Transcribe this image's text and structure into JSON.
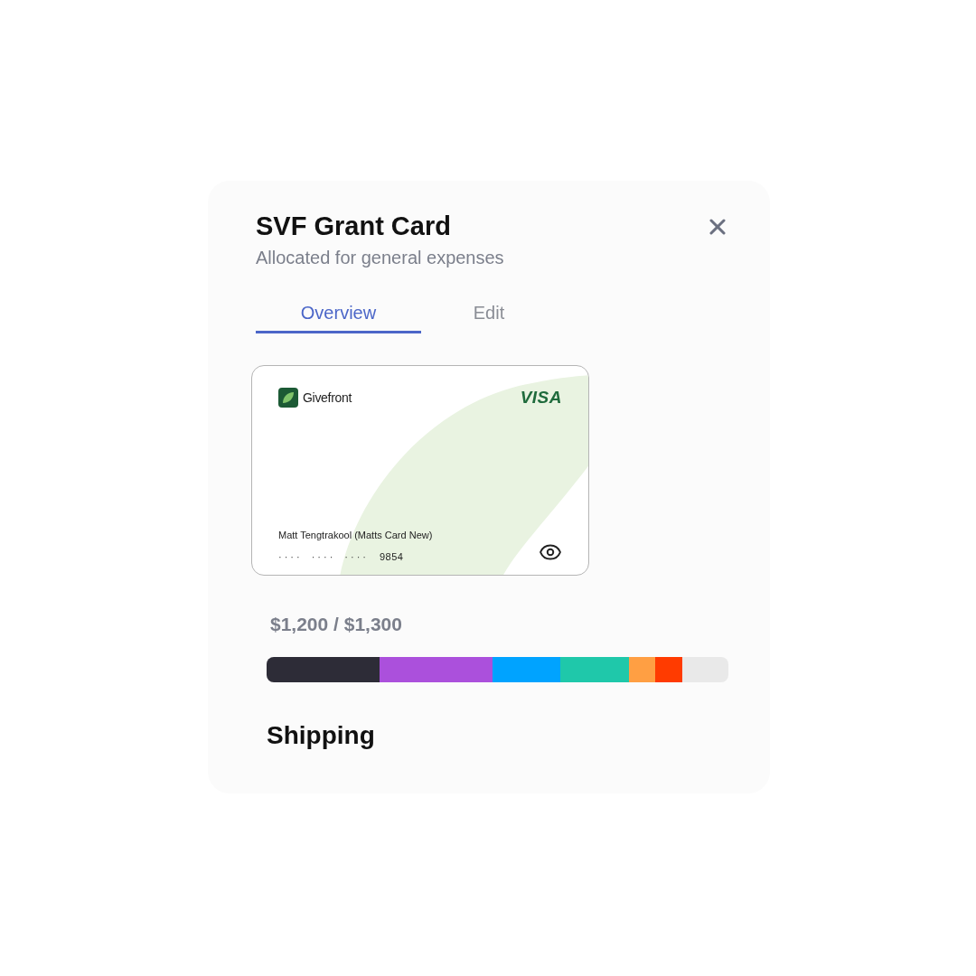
{
  "dialog": {
    "title": "SVF Grant Card",
    "subtitle": "Allocated for general expenses"
  },
  "tabs": [
    {
      "label": "Overview",
      "selected": true
    },
    {
      "label": "Edit",
      "selected": false
    }
  ],
  "card": {
    "brand_name": "Givefront",
    "network": "VISA",
    "holder": "Matt Tengtrakool (Matts Card New)",
    "masked_groups": [
      "····",
      "····",
      "····"
    ],
    "last4": "9854"
  },
  "budget": {
    "amount": "$1,200 / $1,300",
    "segments": [
      {
        "color": "#2d2c37"
      },
      {
        "color": "#ab50dc"
      },
      {
        "color": "#00a3ff"
      },
      {
        "color": "#1fc8aa"
      },
      {
        "color": "#ff9f43"
      },
      {
        "color": "#ff3b00"
      }
    ]
  },
  "section": {
    "heading": "Shipping"
  }
}
